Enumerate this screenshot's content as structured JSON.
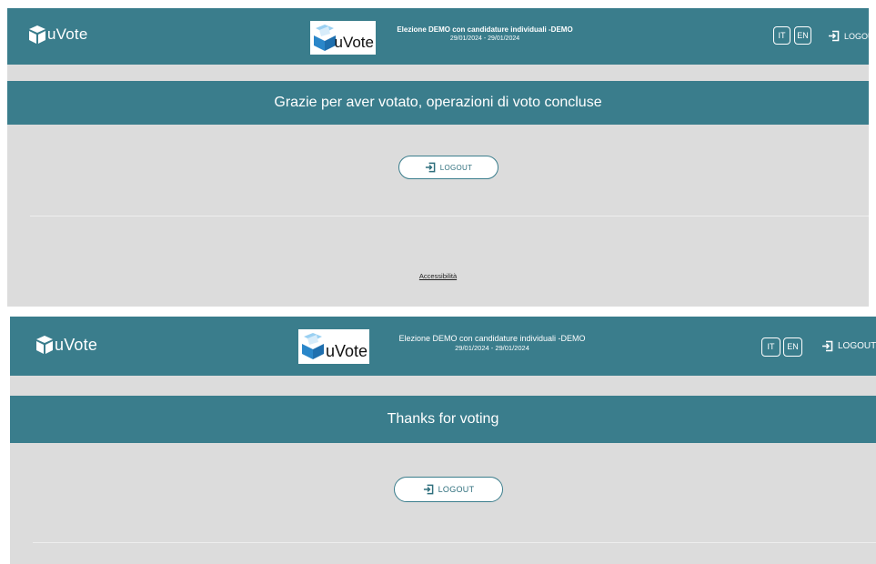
{
  "colors": {
    "header_bg": "#3a7d8c",
    "panel_bg": "#dcdcdc",
    "text_white": "#ffffff"
  },
  "panel_it": {
    "brand": "uVote",
    "election_logo_text": "uVote",
    "election_title": "Elezione DEMO con candidature individuali -DEMO",
    "election_dates": "29/01/2024 - 29/01/2024",
    "lang_it": "IT",
    "lang_en": "EN",
    "header_logout": "LOGOUT",
    "message": "Grazie per aver votato, operazioni di voto concluse",
    "logout_button": "LOGOUT",
    "accessibility_link": "Accessibilità"
  },
  "panel_en": {
    "brand": "uVote",
    "election_logo_text": "uVote",
    "election_title": "Elezione DEMO con candidature individuali -DEMO",
    "election_dates": "29/01/2024 - 29/01/2024",
    "lang_it": "IT",
    "lang_en": "EN",
    "header_logout": "LOGOUT",
    "message": "Thanks for voting",
    "logout_button": "LOGOUT"
  },
  "icons": {
    "brand": "ballot-box-icon",
    "logout": "logout-arrow-icon"
  }
}
